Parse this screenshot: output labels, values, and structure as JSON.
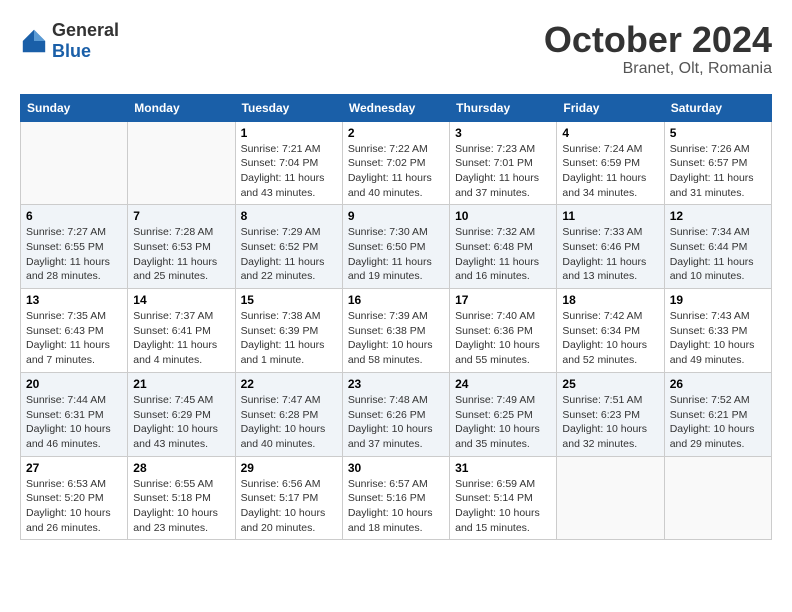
{
  "logo": {
    "general": "General",
    "blue": "Blue"
  },
  "title": "October 2024",
  "location": "Branet, Olt, Romania",
  "weekdays": [
    "Sunday",
    "Monday",
    "Tuesday",
    "Wednesday",
    "Thursday",
    "Friday",
    "Saturday"
  ],
  "weeks": [
    [
      {
        "day": "",
        "info": ""
      },
      {
        "day": "",
        "info": ""
      },
      {
        "day": "1",
        "info": "Sunrise: 7:21 AM\nSunset: 7:04 PM\nDaylight: 11 hours and 43 minutes."
      },
      {
        "day": "2",
        "info": "Sunrise: 7:22 AM\nSunset: 7:02 PM\nDaylight: 11 hours and 40 minutes."
      },
      {
        "day": "3",
        "info": "Sunrise: 7:23 AM\nSunset: 7:01 PM\nDaylight: 11 hours and 37 minutes."
      },
      {
        "day": "4",
        "info": "Sunrise: 7:24 AM\nSunset: 6:59 PM\nDaylight: 11 hours and 34 minutes."
      },
      {
        "day": "5",
        "info": "Sunrise: 7:26 AM\nSunset: 6:57 PM\nDaylight: 11 hours and 31 minutes."
      }
    ],
    [
      {
        "day": "6",
        "info": "Sunrise: 7:27 AM\nSunset: 6:55 PM\nDaylight: 11 hours and 28 minutes."
      },
      {
        "day": "7",
        "info": "Sunrise: 7:28 AM\nSunset: 6:53 PM\nDaylight: 11 hours and 25 minutes."
      },
      {
        "day": "8",
        "info": "Sunrise: 7:29 AM\nSunset: 6:52 PM\nDaylight: 11 hours and 22 minutes."
      },
      {
        "day": "9",
        "info": "Sunrise: 7:30 AM\nSunset: 6:50 PM\nDaylight: 11 hours and 19 minutes."
      },
      {
        "day": "10",
        "info": "Sunrise: 7:32 AM\nSunset: 6:48 PM\nDaylight: 11 hours and 16 minutes."
      },
      {
        "day": "11",
        "info": "Sunrise: 7:33 AM\nSunset: 6:46 PM\nDaylight: 11 hours and 13 minutes."
      },
      {
        "day": "12",
        "info": "Sunrise: 7:34 AM\nSunset: 6:44 PM\nDaylight: 11 hours and 10 minutes."
      }
    ],
    [
      {
        "day": "13",
        "info": "Sunrise: 7:35 AM\nSunset: 6:43 PM\nDaylight: 11 hours and 7 minutes."
      },
      {
        "day": "14",
        "info": "Sunrise: 7:37 AM\nSunset: 6:41 PM\nDaylight: 11 hours and 4 minutes."
      },
      {
        "day": "15",
        "info": "Sunrise: 7:38 AM\nSunset: 6:39 PM\nDaylight: 11 hours and 1 minute."
      },
      {
        "day": "16",
        "info": "Sunrise: 7:39 AM\nSunset: 6:38 PM\nDaylight: 10 hours and 58 minutes."
      },
      {
        "day": "17",
        "info": "Sunrise: 7:40 AM\nSunset: 6:36 PM\nDaylight: 10 hours and 55 minutes."
      },
      {
        "day": "18",
        "info": "Sunrise: 7:42 AM\nSunset: 6:34 PM\nDaylight: 10 hours and 52 minutes."
      },
      {
        "day": "19",
        "info": "Sunrise: 7:43 AM\nSunset: 6:33 PM\nDaylight: 10 hours and 49 minutes."
      }
    ],
    [
      {
        "day": "20",
        "info": "Sunrise: 7:44 AM\nSunset: 6:31 PM\nDaylight: 10 hours and 46 minutes."
      },
      {
        "day": "21",
        "info": "Sunrise: 7:45 AM\nSunset: 6:29 PM\nDaylight: 10 hours and 43 minutes."
      },
      {
        "day": "22",
        "info": "Sunrise: 7:47 AM\nSunset: 6:28 PM\nDaylight: 10 hours and 40 minutes."
      },
      {
        "day": "23",
        "info": "Sunrise: 7:48 AM\nSunset: 6:26 PM\nDaylight: 10 hours and 37 minutes."
      },
      {
        "day": "24",
        "info": "Sunrise: 7:49 AM\nSunset: 6:25 PM\nDaylight: 10 hours and 35 minutes."
      },
      {
        "day": "25",
        "info": "Sunrise: 7:51 AM\nSunset: 6:23 PM\nDaylight: 10 hours and 32 minutes."
      },
      {
        "day": "26",
        "info": "Sunrise: 7:52 AM\nSunset: 6:21 PM\nDaylight: 10 hours and 29 minutes."
      }
    ],
    [
      {
        "day": "27",
        "info": "Sunrise: 6:53 AM\nSunset: 5:20 PM\nDaylight: 10 hours and 26 minutes."
      },
      {
        "day": "28",
        "info": "Sunrise: 6:55 AM\nSunset: 5:18 PM\nDaylight: 10 hours and 23 minutes."
      },
      {
        "day": "29",
        "info": "Sunrise: 6:56 AM\nSunset: 5:17 PM\nDaylight: 10 hours and 20 minutes."
      },
      {
        "day": "30",
        "info": "Sunrise: 6:57 AM\nSunset: 5:16 PM\nDaylight: 10 hours and 18 minutes."
      },
      {
        "day": "31",
        "info": "Sunrise: 6:59 AM\nSunset: 5:14 PM\nDaylight: 10 hours and 15 minutes."
      },
      {
        "day": "",
        "info": ""
      },
      {
        "day": "",
        "info": ""
      }
    ]
  ]
}
